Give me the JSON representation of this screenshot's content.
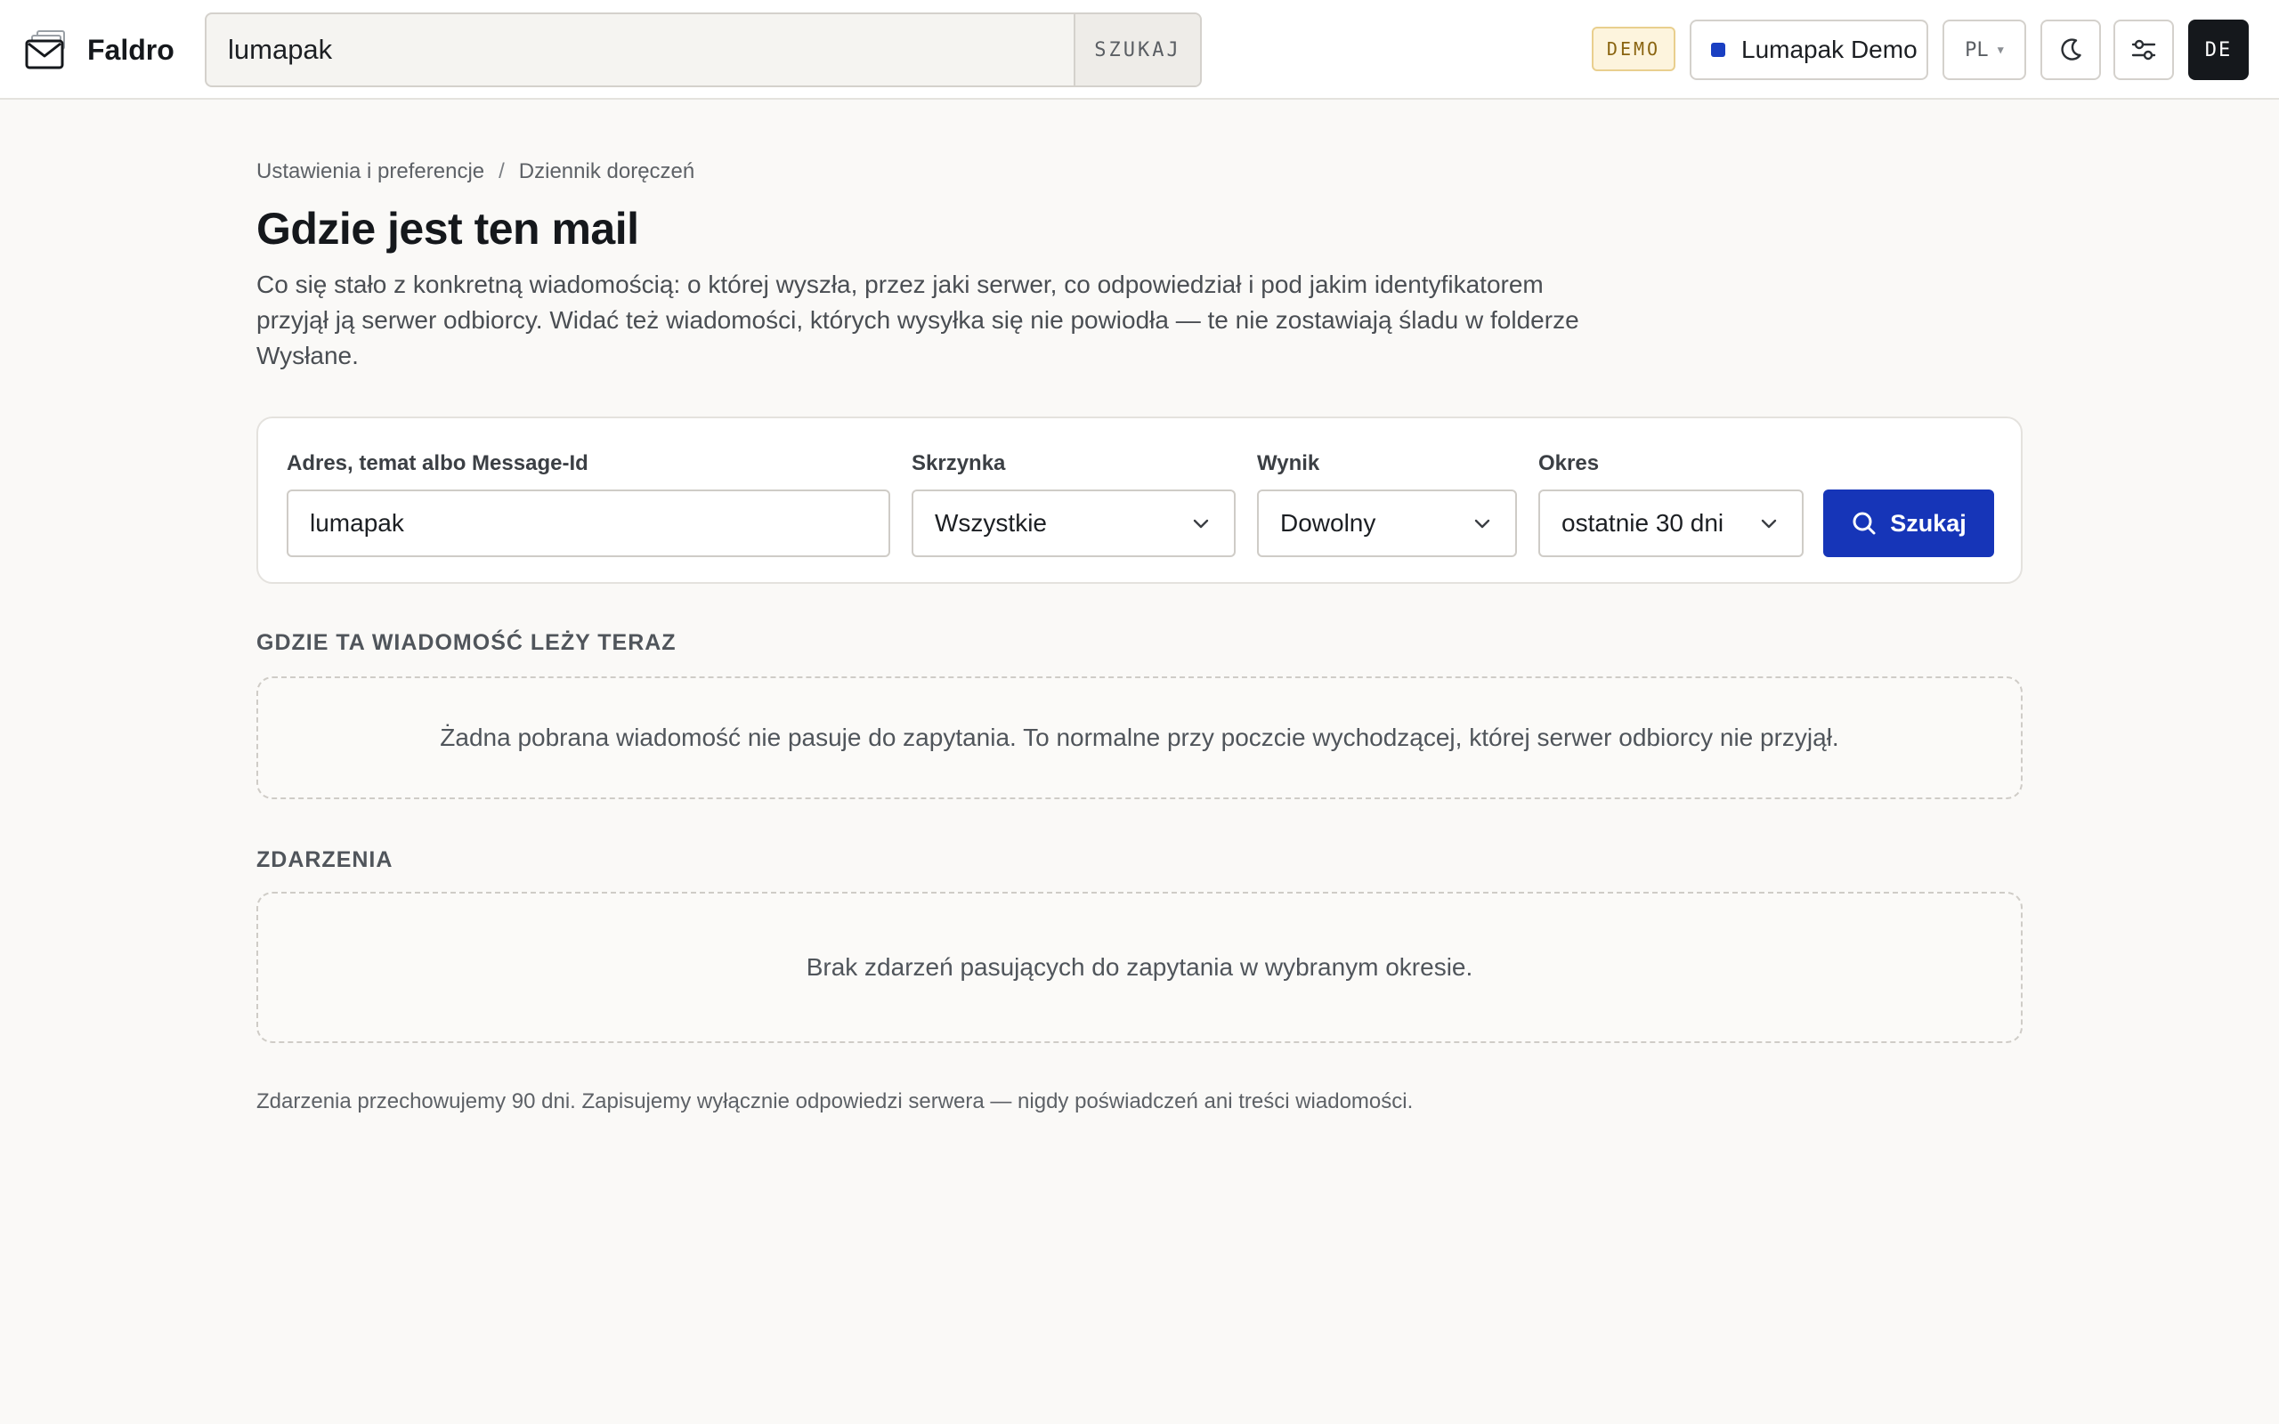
{
  "brand": {
    "name": "Faldro"
  },
  "header": {
    "search_value": "lumapak",
    "search_button": "SZUKAJ",
    "demo_badge": "DEMO",
    "account_name": "Lumapak Demo",
    "account_color": "#1a3fc2",
    "language": "PL",
    "theme_icon": "moon-icon",
    "prefs_icon": "sliders-icon",
    "avatar_initials": "DE"
  },
  "breadcrumb": {
    "items": [
      "Ustawienia i preferencje",
      "Dziennik doręczeń"
    ],
    "separator": "/"
  },
  "page": {
    "title": "Gdzie jest ten mail",
    "description": "Co się stało z konkretną wiadomością: o której wyszła, przez jaki serwer, co odpowiedział i pod jakim identyfikatorem przyjął ją serwer odbiorcy. Widać też wiadomości, których wysyłka się nie powiodła — te nie zostawiają śladu w folderze Wysłane."
  },
  "filters": {
    "query_label": "Adres, temat albo Message-Id",
    "query_value": "lumapak",
    "mailbox_label": "Skrzynka",
    "mailbox_value": "Wszystkie",
    "result_label": "Wynik",
    "result_value": "Dowolny",
    "period_label": "Okres",
    "period_value": "ostatnie 30 dni",
    "search_button": "Szukaj",
    "accent_color": "#1635b8"
  },
  "sections": {
    "where_heading": "GDZIE TA WIADOMOŚĆ LEŻY TERAZ",
    "where_empty": "Żadna pobrana wiadomość nie pasuje do zapytania. To normalne przy poczcie wychodzącej, której serwer odbiorcy nie przyjął.",
    "events_heading": "ZDARZENIA",
    "events_empty": "Brak zdarzeń pasujących do zapytania w wybranym okresie."
  },
  "footer": {
    "note": "Zdarzenia przechowujemy 90 dni. Zapisujemy wyłącznie odpowiedzi serwera — nigdy poświadczeń ani treści wiadomości."
  }
}
